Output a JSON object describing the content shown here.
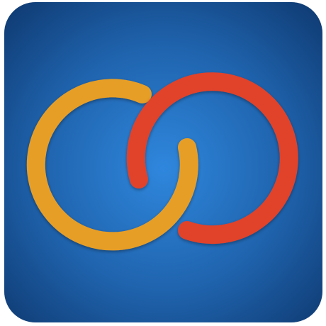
{
  "app_icon": {
    "name": "linked-rings-app-icon",
    "colors": {
      "background_center": "#2f87dd",
      "background_mid": "#1f63ad",
      "background_edge": "#0f3b73",
      "left_ring": "#e79e27",
      "right_ring": "#e1432a"
    }
  }
}
